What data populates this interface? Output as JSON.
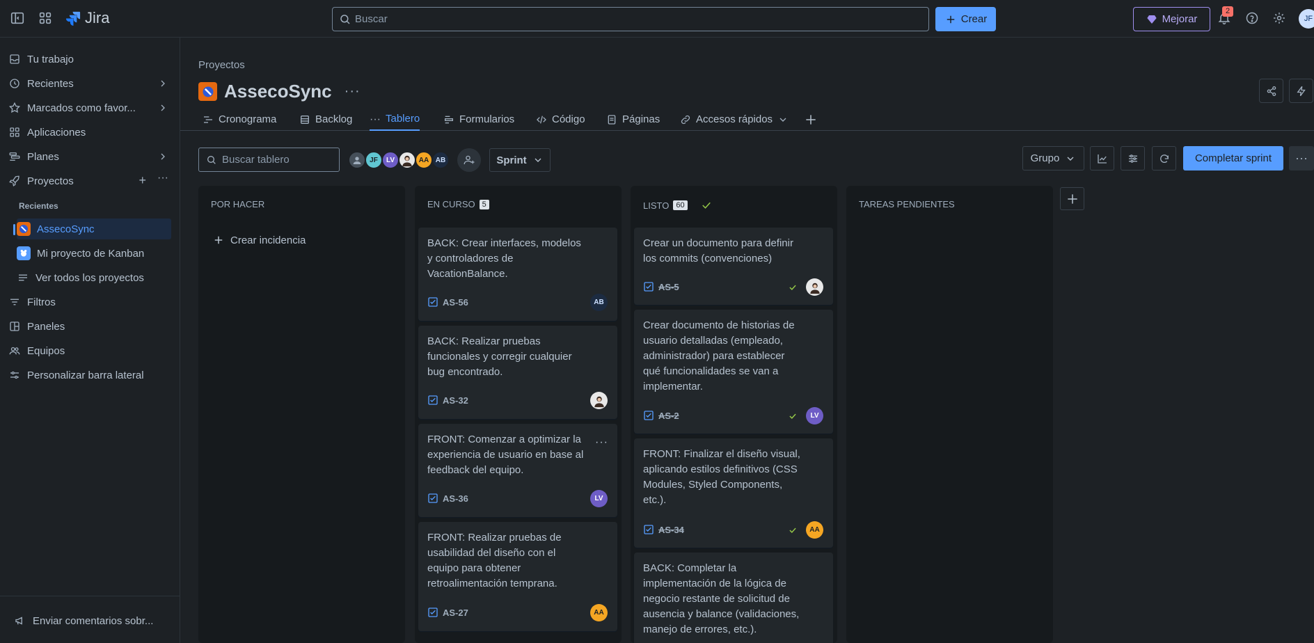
{
  "topbar": {
    "app_name": "Jira",
    "search_placeholder": "Buscar",
    "create_label": "Crear",
    "upgrade_label": "Mejorar",
    "notification_count": "2",
    "user_initials": "JF"
  },
  "sidebar": {
    "tu_trabajo": "Tu trabajo",
    "recientes": "Recientes",
    "marcados": "Marcados como favor...",
    "aplicaciones": "Aplicaciones",
    "planes": "Planes",
    "proyectos": "Proyectos",
    "recientes_heading": "Recientes",
    "project_asseco": "AssecoSync",
    "project_kanban": "Mi proyecto de Kanban",
    "ver_todos": "Ver todos los proyectos",
    "filtros": "Filtros",
    "paneles": "Paneles",
    "equipos": "Equipos",
    "personalizar": "Personalizar barra lateral",
    "feedback": "Enviar comentarios sobr..."
  },
  "header": {
    "breadcrumb": "Proyectos",
    "project_name": "AssecoSync"
  },
  "tabs": {
    "cronograma": "Cronograma",
    "backlog": "Backlog",
    "tablero": "Tablero",
    "formularios": "Formularios",
    "codigo": "Código",
    "paginas": "Páginas",
    "accesos": "Accesos rápidos"
  },
  "toolbar": {
    "board_search_placeholder": "Buscar tablero",
    "avatars": [
      "JF",
      "LV",
      "AA",
      "AB"
    ],
    "sprint_label": "Sprint",
    "group_label": "Grupo",
    "complete_sprint_label": "Completar sprint"
  },
  "columns": {
    "todo": {
      "title": "POR HACER",
      "create_label": "Crear incidencia"
    },
    "inprogress": {
      "title": "EN CURSO",
      "count": "5"
    },
    "done": {
      "title": "LISTO",
      "count": "60"
    },
    "pending": {
      "title": "TAREAS PENDIENTES"
    }
  },
  "cards": {
    "c1": {
      "title": "BACK: Crear interfaces, modelos y controladores de VacationBalance.",
      "key": "AS-56",
      "assignee": "AB"
    },
    "c2": {
      "title": "BACK: Realizar pruebas funcionales y corregir cualquier bug encontrado.",
      "key": "AS-32",
      "assignee": ""
    },
    "c3": {
      "title": "FRONT: Comenzar a optimizar la experiencia de usuario en base al feedback del equipo.",
      "key": "AS-36",
      "assignee": "LV"
    },
    "c4": {
      "title": "FRONT: Realizar pruebas de usabilidad del diseño con el equipo para obtener retroalimentación temprana.",
      "key": "AS-27",
      "assignee": "AA"
    },
    "d1": {
      "title": "Crear un documento para definir los commits (convenciones)",
      "key": "AS-5",
      "assignee": ""
    },
    "d2": {
      "title": "Crear documento de historias de usuario detalladas (empleado, administrador) para establecer qué funcionalidades se van a implementar.",
      "key": "AS-2",
      "assignee": "LV"
    },
    "d3": {
      "title": "FRONT: Finalizar el diseño visual, aplicando estilos definitivos (CSS Modules, Styled Components, etc.).",
      "key": "AS-34",
      "assignee": "AA"
    },
    "d4": {
      "title": "BACK: Completar la implementación de la lógica de negocio restante de solicitud de ausencia y balance (validaciones, manejo de errores, etc.)."
    }
  },
  "colors": {
    "accent": "#579dff",
    "background": "#1d2125",
    "column": "#161a1d",
    "card": "#22272b",
    "avatar_lv": "#6e5dc6",
    "avatar_aa": "#f5a623",
    "avatar_ab": "#1c2b41",
    "avatar_jf": "#60c6d2"
  }
}
